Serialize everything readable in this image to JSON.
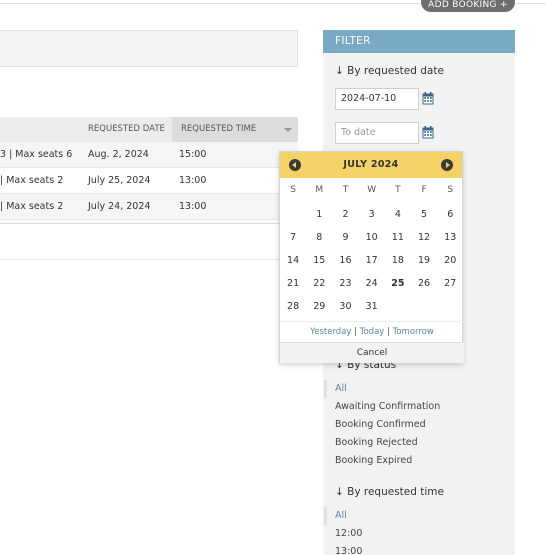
{
  "header": {
    "add_button": "ADD BOOKING +"
  },
  "table": {
    "columns": {
      "requested_date": "REQUESTED DATE",
      "requested_time": "REQUESTED TIME"
    },
    "rows": [
      {
        "desc": "3 | Max seats 6",
        "date": "Aug. 2, 2024",
        "time": "15:00"
      },
      {
        "desc": "| Max seats 2",
        "date": "July 25, 2024",
        "time": "13:00"
      },
      {
        "desc": "| Max seats 2",
        "date": "July 24, 2024",
        "time": "13:00"
      }
    ]
  },
  "filter": {
    "title": "FILTER",
    "by_date": {
      "title": "↓ By requested date",
      "from_value": "2024-07-10",
      "to_placeholder": "To date"
    },
    "by_status": {
      "title": "↓ By status",
      "items": [
        "All",
        "Awaiting Confirmation",
        "Booking Confirmed",
        "Booking Rejected",
        "Booking Expired"
      ]
    },
    "by_time": {
      "title": "↓ By requested time",
      "items": [
        "All",
        "12:00",
        "13:00"
      ]
    }
  },
  "datepicker": {
    "month_label": "JULY 2024",
    "weekdays": [
      "S",
      "M",
      "T",
      "W",
      "T",
      "F",
      "S"
    ],
    "weeks": [
      [
        "",
        "1",
        "2",
        "3",
        "4",
        "5",
        "6"
      ],
      [
        "7",
        "8",
        "9",
        "10",
        "11",
        "12",
        "13"
      ],
      [
        "14",
        "15",
        "16",
        "17",
        "18",
        "19",
        "20"
      ],
      [
        "21",
        "22",
        "23",
        "24",
        "25",
        "26",
        "27"
      ],
      [
        "28",
        "29",
        "30",
        "31",
        "",
        "",
        ""
      ]
    ],
    "today": "25",
    "links": {
      "yesterday": "Yesterday",
      "today": "Today",
      "tomorrow": "Tomorrow"
    },
    "cancel": "Cancel"
  },
  "colors": {
    "filter_header": "#78a9c5",
    "datepicker_header": "#f3d366",
    "link": "#5a86ad",
    "calendar_icon": "#3d6788"
  }
}
